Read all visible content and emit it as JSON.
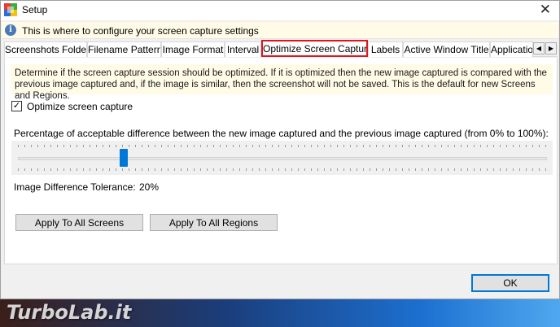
{
  "window": {
    "title": "Setup",
    "close_glyph": "✕",
    "info_text": "This is where to configure your screen capture settings",
    "info_glyph": "i"
  },
  "tabs": [
    {
      "label": "Screenshots Folder",
      "selected": false
    },
    {
      "label": "Filename Pattern",
      "selected": false
    },
    {
      "label": "Image Format",
      "selected": false
    },
    {
      "label": "Interval",
      "selected": false
    },
    {
      "label": "Optimize Screen Capture",
      "selected": true
    },
    {
      "label": "Labels",
      "selected": false
    },
    {
      "label": "Active Window Title",
      "selected": false
    },
    {
      "label": "Application",
      "selected": false
    }
  ],
  "tab_scroll": {
    "left_glyph": "◀",
    "right_glyph": "▶"
  },
  "panel": {
    "description": "Determine if the screen capture session should be optimized. If it is optimized then the new image captured is compared with the previous image captured and, if the image is similar, then the screenshot will not be saved. This is the default for new Screens and Regions.",
    "optimize_checkbox": {
      "label": "Optimize screen capture",
      "checked": true,
      "glyph": "✓"
    },
    "percentage_label": "Percentage of acceptable difference between the new image captured and the previous image captured (from 0% to 100%):",
    "slider": {
      "min": 0,
      "max": 100,
      "value": 20
    },
    "tolerance_label": "Image Difference Tolerance:",
    "tolerance_value": "20%",
    "apply_screens_label": "Apply To All Screens",
    "apply_regions_label": "Apply To All Regions"
  },
  "footer": {
    "ok_label": "OK"
  },
  "watermark": "TurboLab.it",
  "colors": {
    "accent": "#0078d7",
    "tab_highlight": "#e0141e",
    "info_bg": "#fffbe6"
  }
}
